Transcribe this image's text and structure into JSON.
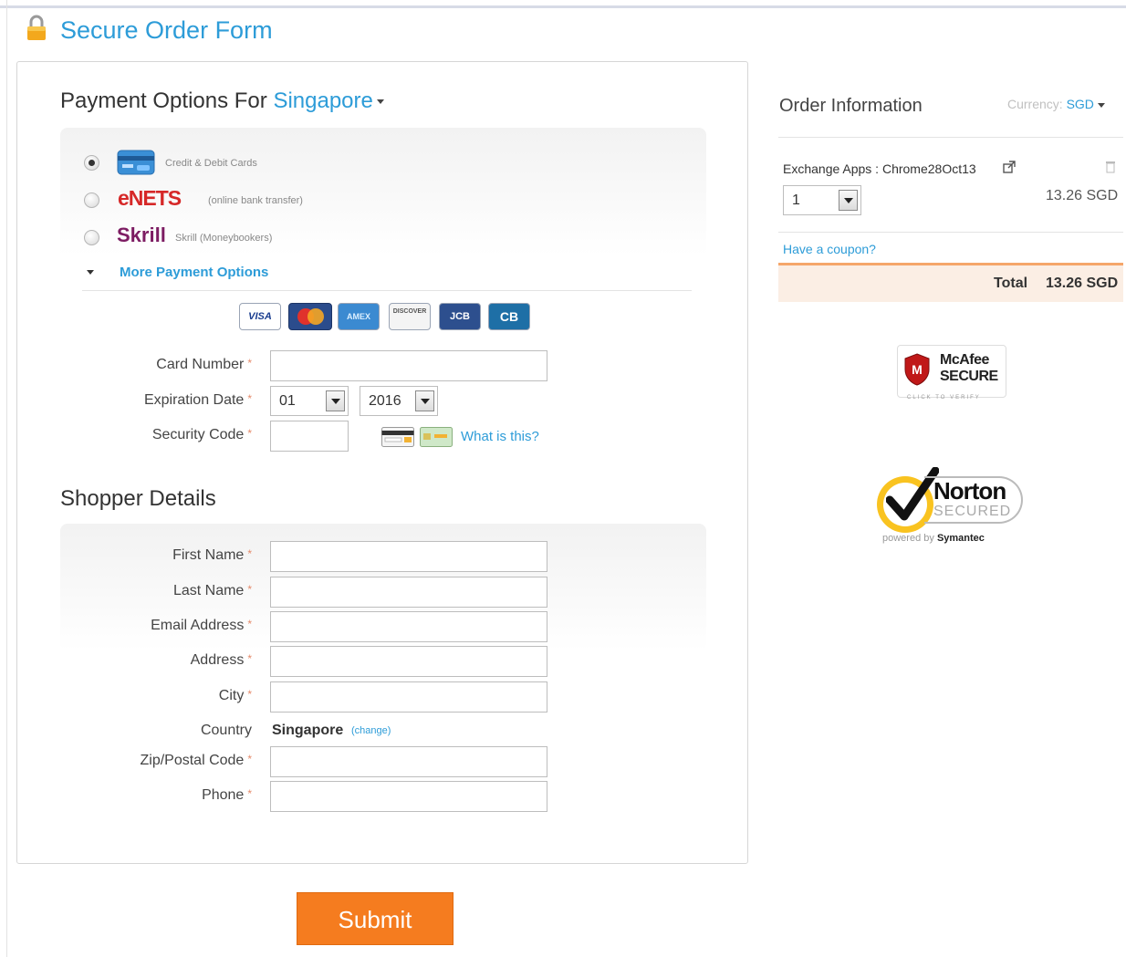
{
  "page_title": "Secure Order Form",
  "payment": {
    "heading_prefix": "Payment Options For",
    "country": "Singapore",
    "methods": [
      {
        "name": "cards",
        "description": "Credit & Debit Cards",
        "selected": true
      },
      {
        "name": "eNETS",
        "description": "(online bank transfer)",
        "selected": false
      },
      {
        "name": "Skrill",
        "description": "Skrill (Moneybookers)",
        "selected": false
      }
    ],
    "more_options": "More Payment Options",
    "card_brands": [
      "VISA",
      "MC",
      "AMEX",
      "DISCOVER",
      "JCB",
      "CB"
    ],
    "card_number_label": "Card Number",
    "expiration_label": "Expiration Date",
    "exp_month": "01",
    "exp_year": "2016",
    "security_code_label": "Security Code",
    "what_is_this": "What is this?",
    "required_marker": "*"
  },
  "shopper": {
    "heading": "Shopper Details",
    "first_name_label": "First Name",
    "last_name_label": "Last Name",
    "email_label": "Email Address",
    "address_label": "Address",
    "city_label": "City",
    "country_label": "Country",
    "country_value": "Singapore",
    "change_link": "(change)",
    "zip_label": "Zip/Postal Code",
    "phone_label": "Phone"
  },
  "order": {
    "heading": "Order Information",
    "currency_label": "Currency:",
    "currency_value": "SGD",
    "product_name": "Exchange Apps : Chrome28Oct13",
    "quantity": "1",
    "line_price": "13.26 SGD",
    "coupon_link": "Have a coupon?",
    "total_label": "Total",
    "total_value": "13.26 SGD"
  },
  "badges": {
    "mcafee_line1": "McAfee",
    "mcafee_line2": "SECURE",
    "mcafee_sub": "CLICK TO VERIFY",
    "norton_line1": "Norton",
    "norton_line2": "SECURED",
    "norton_powered": "powered by",
    "norton_brand": "Symantec"
  },
  "submit_label": "Submit",
  "colors": {
    "accent_blue": "#2d9cd8",
    "submit_orange": "#f57c1f",
    "total_bg": "#fbeee4"
  }
}
